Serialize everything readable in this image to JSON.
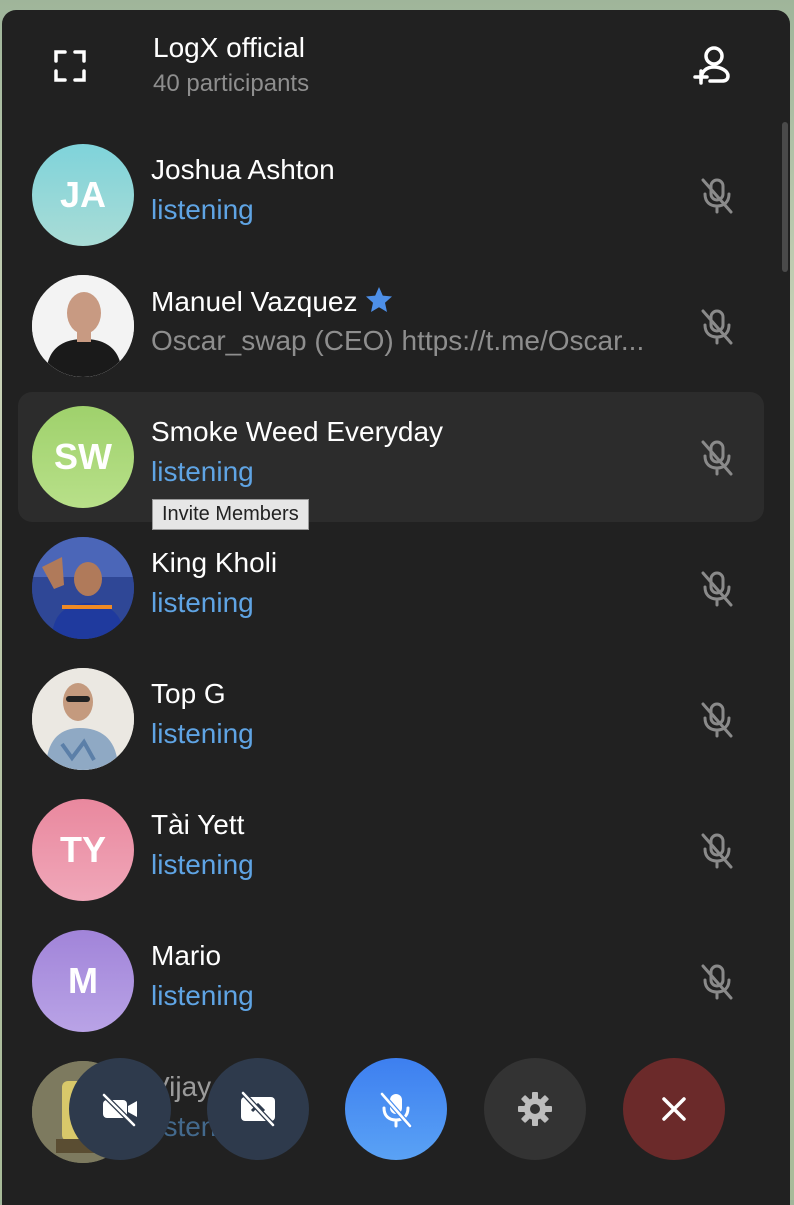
{
  "header": {
    "title": "LogX official",
    "subtitle": "40 participants"
  },
  "participants": [
    {
      "name": "Joshua Ashton",
      "status": "listening",
      "initials": "JA",
      "colors": [
        "#7fd3da",
        "#a9dcd6"
      ]
    },
    {
      "name": "Manuel Vazquez",
      "status": "Oscar_swap (CEO) https://t.me/Oscar...",
      "photo": "profile-photo"
    },
    {
      "name": "Smoke Weed Everyday",
      "status": "listening",
      "initials": "SW",
      "colors": [
        "#9fd16c",
        "#b8e089"
      ]
    },
    {
      "name": "King Kholi",
      "status": "listening",
      "photo": "profile-photo"
    },
    {
      "name": "Top G",
      "status": "listening",
      "photo": "profile-photo"
    },
    {
      "name": "Tài Yett",
      "status": "listening",
      "initials": "TY",
      "colors": [
        "#e9889e",
        "#f0a7b9"
      ]
    },
    {
      "name": "Mario",
      "status": "listening",
      "initials": "M",
      "colors": [
        "#a184d9",
        "#b9a3e6"
      ]
    },
    {
      "name": "Vijay",
      "status": "listening",
      "photo": "profile-photo"
    }
  ],
  "tooltip": "Invite Members",
  "controls": [
    {
      "name": "video-off-button",
      "icon": "video-off-icon",
      "color": "#2e3a4c"
    },
    {
      "name": "screen-share-off-button",
      "icon": "screen-share-off-icon",
      "color": "#2e3a4c"
    },
    {
      "name": "mute-button",
      "icon": "mic-off-icon",
      "color": "#4a8ff0"
    },
    {
      "name": "settings-button",
      "icon": "gear-icon",
      "color": "#333333"
    },
    {
      "name": "leave-button",
      "icon": "close-icon",
      "color": "#6b2a2a"
    }
  ],
  "accent_color": "#5fa4e4"
}
